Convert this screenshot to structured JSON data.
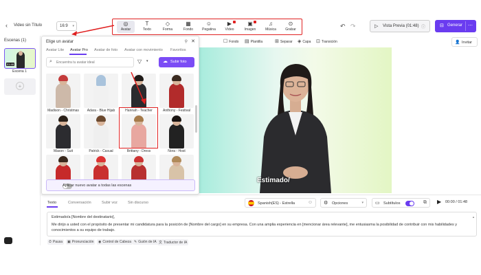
{
  "header": {
    "project_title": "Video sin Título",
    "aspect_ratio": "16:9",
    "tools": [
      {
        "label": "Avatar",
        "icon": "avatar-icon"
      },
      {
        "label": "Texto",
        "icon": "text-icon"
      },
      {
        "label": "Forma",
        "icon": "shape-icon"
      },
      {
        "label": "Fondo",
        "icon": "background-icon"
      },
      {
        "label": "Pegatina",
        "icon": "sticker-icon"
      },
      {
        "label": "Vídeo",
        "icon": "video-icon"
      },
      {
        "label": "Imagen",
        "icon": "image-icon"
      },
      {
        "label": "Música",
        "icon": "music-icon"
      },
      {
        "label": "Grabar",
        "icon": "record-icon"
      }
    ],
    "preview_label": "Vista Previa (01:48)",
    "generate_label": "Generar"
  },
  "scenes": {
    "title": "Escenas (1)",
    "items": [
      {
        "label": "Escena 1",
        "time": "01:48"
      }
    ]
  },
  "avatar_panel": {
    "title": "Elige un avatar",
    "tabs": [
      "Avatar Lite",
      "Avatar Pro",
      "Avatar de foto",
      "Avatar con movimiento",
      "Favoritos"
    ],
    "search_placeholder": "Encuentra tu avatar ideal",
    "upload_label": "Subir foto",
    "avatars": [
      "Madison - Christmas",
      "Adara - Blue Hijab",
      "Hannah - Teacher",
      "Anthony - Festival",
      "Mason - Suit",
      "Patrick - Casual",
      "Brittany - Dress",
      "Nora - Host",
      "",
      "",
      "",
      ""
    ],
    "apply_all_label": "Aplicar nuevo avatar a todas las escenas"
  },
  "canvas_toolbar": {
    "items": [
      "Fondo",
      "Plantilla",
      "Separar",
      "Capa",
      "Transición"
    ],
    "invite_label": "Invitar"
  },
  "canvas": {
    "caption": "Estimado/"
  },
  "script_editor": {
    "tabs": [
      "Texto",
      "Conversación",
      "Subir voz",
      "Sin discurso"
    ],
    "voice": "Spanish(ES) - Estrella",
    "options_label": "Opciones",
    "subtitles_label": "Subtítulos",
    "time": "00:00 / 01:48",
    "lines": [
      "Estimado/a [Nombre del destinatario],",
      "Me dirijo a usted con el propósito de presentar mi candidatura para la posición de [Nombre del cargo] en su empresa. Con una amplia experiencia en [mencionar área relevante], me entusiasma la posibilidad de contribuir con mis habilidades y conocimientos a su equipo de trabajo."
    ],
    "chips": [
      "Pausa",
      "Pronunciación",
      "Control de Cabeza",
      "Guión de IA",
      "Traductor de IA"
    ]
  },
  "colors": {
    "accent": "#6a3cf0",
    "highlight": "#e02020"
  }
}
